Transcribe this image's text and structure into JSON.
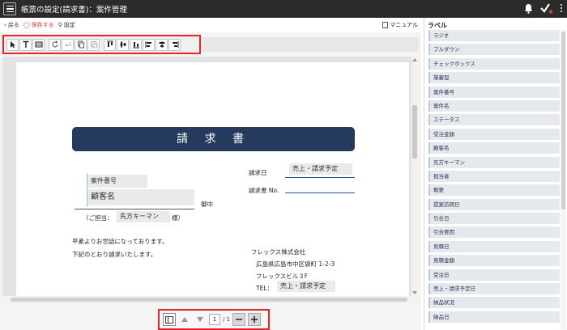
{
  "header": {
    "title": "帳票の設定(請求書)：案件管理"
  },
  "actions": {
    "back": "戻る",
    "save": "保存する",
    "settings": "設定",
    "manual": "マニュアル"
  },
  "pager": {
    "current": "1",
    "total": "/ 1"
  },
  "document": {
    "title": "請 求 書",
    "case_number": "案件番号",
    "client_name": "顧客名",
    "honorific": "御中",
    "contact_prefix": "（ご担当：",
    "contact_field": "先方キーマン",
    "contact_suffix": "様）",
    "invoice_date_label": "請求日",
    "invoice_date_value": "売上・請求予定",
    "invoice_no_label": "請求書 No.",
    "greeting_1": "平素よりお世話になっております。",
    "greeting_2": "下記のとおり請求いたします。",
    "company_name": "フレックス株式会社",
    "company_address": "広島県広島市中区袋町 1-2-3",
    "company_building": "フレックスビル３F",
    "tel_label": "TEL：",
    "tel_value": "売上・請求予定"
  },
  "labels_panel": {
    "title": "ラベル",
    "items": [
      "ラジオ",
      "プルダウン",
      "チェックボックス",
      "施審型",
      "案件番号",
      "案件名",
      "ステータス",
      "受注金額",
      "顧客名",
      "先方キーマン",
      "担当者",
      "概要",
      "提案訪問日",
      "引合日",
      "引合要因",
      "見積日",
      "見積金額",
      "受注日",
      "売上・請求予定日",
      "納品状況",
      "納品日"
    ]
  }
}
